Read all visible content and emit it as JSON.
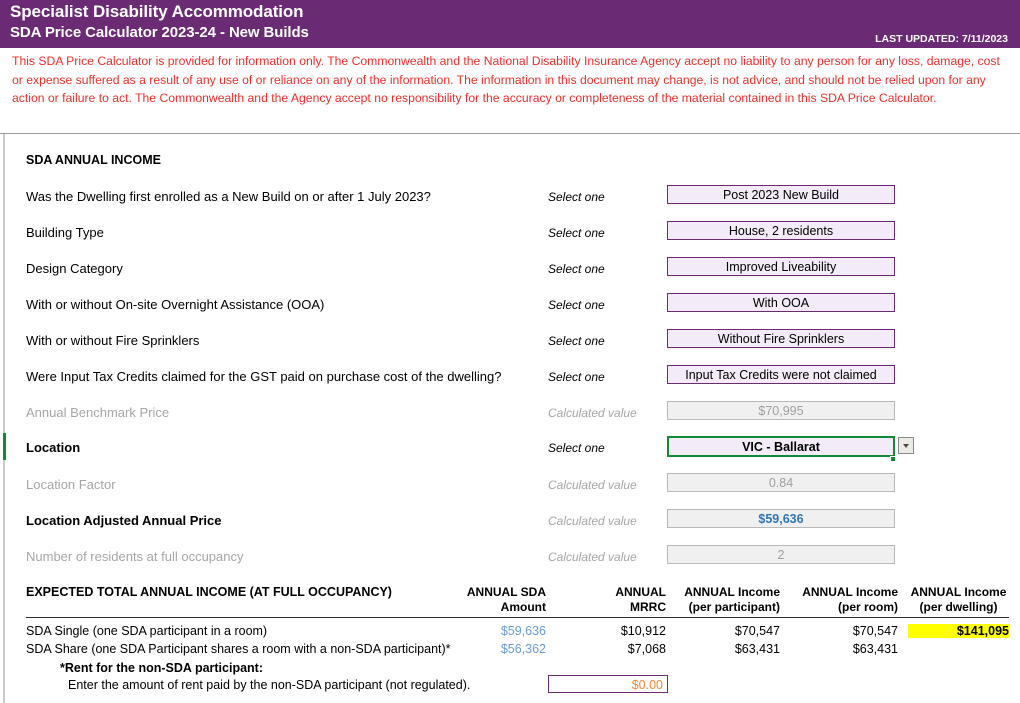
{
  "banner": {
    "title": "Specialist Disability Accommodation",
    "subtitle": "SDA Price Calculator 2023-24 - New Builds",
    "last_updated": "LAST UPDATED: 7/11/2023",
    "bg_color": "#6b2a74"
  },
  "disclaimer": {
    "text": "This SDA Price Calculator is provided for information only.  The Commonwealth and the National Disability Insurance Agency accept no liability to any person for any loss, damage, cost or expense suffered as a result of any use of or reliance on any of the information.  The information in this document may change, is not advice, and should not be relied upon for any action or failure to act. The Commonwealth and the Agency accept no responsibility for the accuracy or completeness of the material contained in this SDA Price Calculator.",
    "color": "#e8302a"
  },
  "section": {
    "title": "SDA ANNUAL INCOME"
  },
  "hints": {
    "select_one": "Select one",
    "calculated_value": "Calculated value"
  },
  "form_rows": [
    {
      "label": "Was the Dwelling first enrolled as a New Build on or after 1 July 2023?",
      "hint": "Select one",
      "value": "Post 2023 New Build",
      "kind": "select"
    },
    {
      "label": "Building Type",
      "hint": "Select one",
      "value": "House, 2 residents",
      "kind": "select"
    },
    {
      "label": "Design Category",
      "hint": "Select one",
      "value": "Improved Liveability",
      "kind": "select"
    },
    {
      "label": "With or without On-site Overnight Assistance (OOA)",
      "hint": "Select one",
      "value": "With OOA",
      "kind": "select"
    },
    {
      "label": "With or without Fire Sprinklers",
      "hint": "Select one",
      "value": "Without Fire Sprinklers",
      "kind": "select"
    },
    {
      "label": "Were Input Tax Credits claimed for the GST paid on purchase cost of the dwelling?",
      "hint": "Select one",
      "value": "Input Tax Credits were not claimed",
      "kind": "select"
    },
    {
      "label": "Annual Benchmark Price",
      "hint": "Calculated value",
      "value": "$70,995",
      "kind": "calc"
    },
    {
      "label": "Location",
      "hint": "Select one",
      "value": "VIC - Ballarat",
      "kind": "active"
    },
    {
      "label": "Location Factor",
      "hint": "Calculated value",
      "value": "0.84",
      "kind": "calc"
    },
    {
      "label": "Location Adjusted Annual Price",
      "hint": "Calculated value",
      "value": "$59,636",
      "kind": "calc-accent"
    },
    {
      "label": "Number of residents at full occupancy",
      "hint": "Calculated value",
      "value": "2",
      "kind": "calc"
    }
  ],
  "results_table": {
    "title": "EXPECTED TOTAL ANNUAL INCOME (AT FULL OCCUPANCY)",
    "columns": [
      {
        "line1": "ANNUAL SDA",
        "line2": "Amount",
        "highlight": false
      },
      {
        "line1": "ANNUAL",
        "line2": "MRRC",
        "highlight": false
      },
      {
        "line1": "ANNUAL Income",
        "line2": "(per participant)",
        "highlight": false
      },
      {
        "line1": "ANNUAL Income",
        "line2": "(per room)",
        "highlight": false
      },
      {
        "line1": "ANNUAL Income",
        "line2": "(per dwelling)",
        "highlight": true
      }
    ],
    "rows": [
      {
        "label": "SDA Single (one SDA participant in a room)",
        "sda_amount": "$59,636",
        "mrrc": "$10,912",
        "per_participant": "$70,547",
        "per_room": "$70,547",
        "per_dwelling": "$141,095"
      },
      {
        "label": "SDA Share (one SDA Participant shares a room with a non-SDA participant)*",
        "sda_amount": "$56,362",
        "mrrc": "$7,068",
        "per_participant": "$63,431",
        "per_room": "$63,431",
        "per_dwelling": ""
      }
    ]
  },
  "rent_note": {
    "bold_line": "*Rent for the non-SDA participant:",
    "plain_line": "Enter the amount of rent paid by the non-SDA participant (not regulated).",
    "input_value": "$0.00"
  },
  "icons": {
    "dropdown_arrow": "chevron-down-icon",
    "fill_handle": "fill-handle-icon"
  },
  "colors": {
    "brand_purple": "#6b2a74",
    "select_fill": "#f3ebf8",
    "calc_fill": "#f0f0f0",
    "accent_blue": "#2e75b6",
    "light_blue": "#6c9cd2",
    "highlight_yellow": "#ffff00",
    "selection_green": "#128a36",
    "input_orange": "#ed8b35"
  }
}
